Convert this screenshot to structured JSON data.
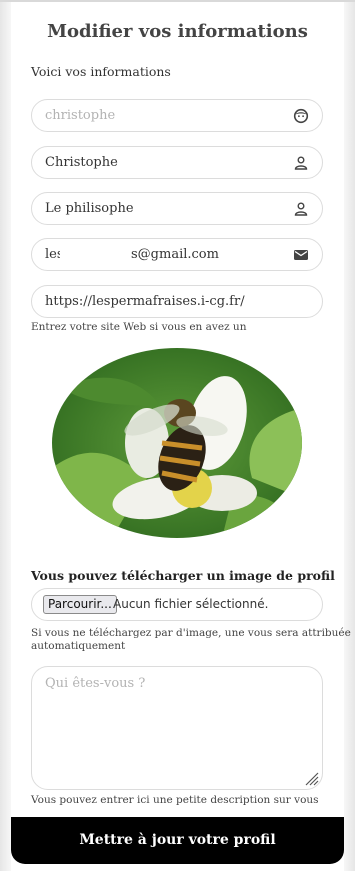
{
  "page": {
    "title": "Modifier vos informations",
    "subtitle": "Voici vos informations"
  },
  "fields": {
    "username": {
      "value": "christophe",
      "is_placeholder": true,
      "icon": "face-icon"
    },
    "firstname": {
      "value": "Christophe",
      "icon": "user-icon"
    },
    "lastname": {
      "value": "Le philisophe",
      "icon": "user-icon"
    },
    "email": {
      "value_start": "les",
      "value_end": "s@gmail.com",
      "icon": "envelope-icon"
    },
    "website": {
      "value": "https://lespermafraises.i-cg.fr/",
      "help": "Entrez votre site Web si vous en avez un"
    }
  },
  "profile_image": {
    "subject": "bee on white strawberry flower",
    "upload_title": "Vous pouvez télécharger un image de profil",
    "browse_label": "Parcourir...",
    "file_status": "Aucun fichier sélectionné.",
    "help": "Si vous ne téléchargez par d'image, une vous sera attribuée automatiquement"
  },
  "description": {
    "placeholder": "Qui êtes-vous ?",
    "help": "Vous pouvez entrer ici une petite description sur vous"
  },
  "submit_label": "Mettre à jour votre profil",
  "colors": {
    "submit_bg": "#000000",
    "field_border": "#dcdcdc",
    "placeholder": "#b3b3b3"
  }
}
